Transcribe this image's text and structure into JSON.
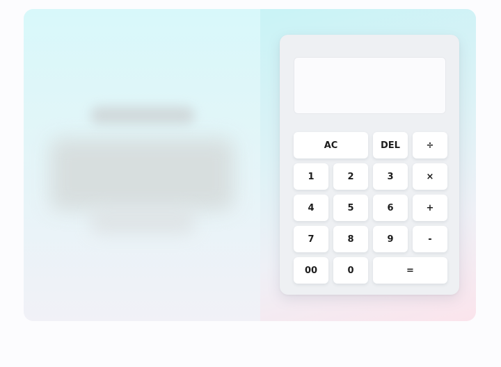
{
  "calculator": {
    "display_value": "",
    "keys": [
      {
        "label": "AC",
        "name": "all-clear-button",
        "wide": true
      },
      {
        "label": "DEL",
        "name": "delete-button",
        "wide": false
      },
      {
        "label": "÷",
        "name": "divide-button",
        "wide": false
      },
      {
        "label": "1",
        "name": "digit-1-button",
        "wide": false
      },
      {
        "label": "2",
        "name": "digit-2-button",
        "wide": false
      },
      {
        "label": "3",
        "name": "digit-3-button",
        "wide": false
      },
      {
        "label": "×",
        "name": "multiply-button",
        "wide": false
      },
      {
        "label": "4",
        "name": "digit-4-button",
        "wide": false
      },
      {
        "label": "5",
        "name": "digit-5-button",
        "wide": false
      },
      {
        "label": "6",
        "name": "digit-6-button",
        "wide": false
      },
      {
        "label": "+",
        "name": "add-button",
        "wide": false
      },
      {
        "label": "7",
        "name": "digit-7-button",
        "wide": false
      },
      {
        "label": "8",
        "name": "digit-8-button",
        "wide": false
      },
      {
        "label": "9",
        "name": "digit-9-button",
        "wide": false
      },
      {
        "label": "-",
        "name": "subtract-button",
        "wide": false
      },
      {
        "label": "00",
        "name": "double-zero-button",
        "wide": false
      },
      {
        "label": "0",
        "name": "digit-0-button",
        "wide": false
      },
      {
        "label": "=",
        "name": "equals-button",
        "wide": true
      }
    ]
  }
}
